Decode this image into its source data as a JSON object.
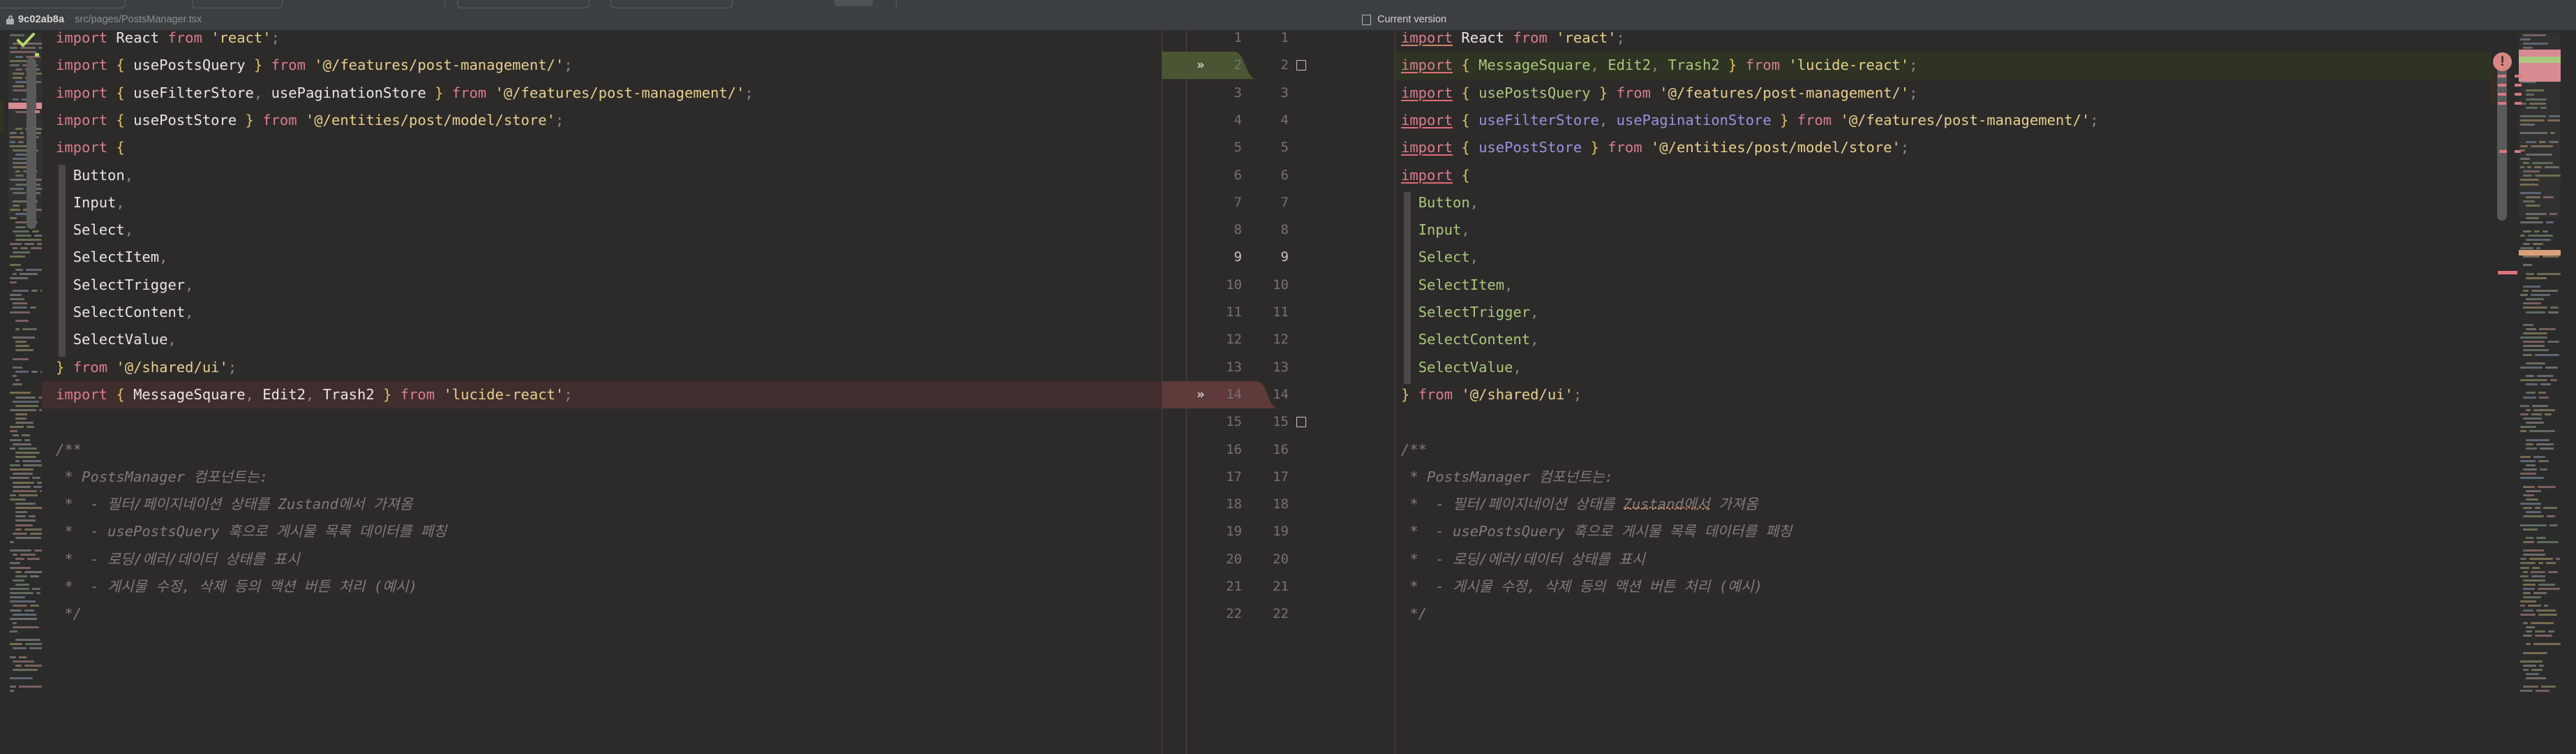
{
  "window": {
    "commit_hash": "9c02ab8a",
    "file_path": "src/pages/PostsManager.tsx",
    "current_version_label": "Current version",
    "lock_icon": "lock-icon",
    "checkmark_icon": "checkmark-icon",
    "error_badge_icon": "error-exclamation-icon",
    "error_badge_symbol": "!"
  },
  "colors": {
    "editor_bg": "#2d2a2a",
    "chrome_bg": "#3c3f41",
    "added_line_bg": "#2e3323",
    "removed_line_bg": "#402d2d",
    "added_gutter_band": "#4a5534",
    "removed_gutter_band": "#5e3a3a",
    "keyword": "#cf8e6d",
    "keyword_import": "#d97e8c",
    "string": "#e7d08c",
    "brace": "#e0c060",
    "identifier": "#e8e6e3",
    "imported_symbol_green": "#a9c77d",
    "imported_symbol_purple": "#9a93e1",
    "comment": "#7f7b77",
    "error_red": "#e06c75",
    "spellcheck_orange": "#c9866a",
    "error_badge": "#d98680",
    "scrollbar_thumb": "#5a5a5a"
  },
  "left_pane": {
    "name": "left-diff-pane",
    "lines": [
      {
        "n": 1,
        "state": "normal"
      },
      {
        "n": 2,
        "state": "normal"
      },
      {
        "n": 3,
        "state": "normal"
      },
      {
        "n": 4,
        "state": "normal"
      },
      {
        "n": 5,
        "state": "normal"
      },
      {
        "n": 6,
        "state": "normal"
      },
      {
        "n": 7,
        "state": "normal"
      },
      {
        "n": 8,
        "state": "normal"
      },
      {
        "n": 9,
        "state": "normal"
      },
      {
        "n": 10,
        "state": "normal"
      },
      {
        "n": 11,
        "state": "normal"
      },
      {
        "n": 12,
        "state": "normal"
      },
      {
        "n": 13,
        "state": "normal"
      },
      {
        "n": 14,
        "state": "removed"
      },
      {
        "n": 15,
        "state": "normal"
      },
      {
        "n": 16,
        "state": "normal"
      },
      {
        "n": 17,
        "state": "normal"
      },
      {
        "n": 18,
        "state": "normal"
      },
      {
        "n": 19,
        "state": "normal"
      },
      {
        "n": 20,
        "state": "normal"
      },
      {
        "n": 21,
        "state": "normal"
      },
      {
        "n": 22,
        "state": "normal"
      }
    ],
    "text": [
      "import React from 'react';",
      "import { usePostsQuery } from '@/features/post-management/';",
      "import { useFilterStore, usePaginationStore } from '@/features/post-management/';",
      "import { usePostStore } from '@/entities/post/model/store';",
      "import {",
      "  Button,",
      "  Input,",
      "  Select,",
      "  SelectItem,",
      "  SelectTrigger,",
      "  SelectContent,",
      "  SelectValue,",
      "} from '@/shared/ui';",
      "import { MessageSquare, Edit2, Trash2 } from 'lucide-react';",
      "",
      "/**",
      " * PostsManager 컴포넌트는:",
      " *  - 필터/페이지네이션 상태를 Zustand에서 가져옴",
      " *  - usePostsQuery 훅으로 게시물 목록 데이터를 페칭",
      " *  - 로딩/에러/데이터 상태를 표시",
      " *  - 게시물 수정, 삭제 등의 액션 버튼 처리 (예시)",
      " */"
    ]
  },
  "right_pane": {
    "name": "right-diff-pane",
    "lines": [
      {
        "n": 1,
        "state": "normal"
      },
      {
        "n": 2,
        "state": "added"
      },
      {
        "n": 3,
        "state": "normal"
      },
      {
        "n": 4,
        "state": "normal"
      },
      {
        "n": 5,
        "state": "normal"
      },
      {
        "n": 6,
        "state": "normal"
      },
      {
        "n": 7,
        "state": "normal"
      },
      {
        "n": 8,
        "state": "normal"
      },
      {
        "n": 9,
        "state": "normal"
      },
      {
        "n": 10,
        "state": "normal"
      },
      {
        "n": 11,
        "state": "normal"
      },
      {
        "n": 12,
        "state": "normal"
      },
      {
        "n": 13,
        "state": "normal"
      },
      {
        "n": 14,
        "state": "normal"
      },
      {
        "n": 15,
        "state": "normal"
      },
      {
        "n": 16,
        "state": "normal"
      },
      {
        "n": 17,
        "state": "normal"
      },
      {
        "n": 18,
        "state": "normal"
      },
      {
        "n": 19,
        "state": "normal"
      },
      {
        "n": 20,
        "state": "normal"
      },
      {
        "n": 21,
        "state": "normal"
      },
      {
        "n": 22,
        "state": "normal"
      }
    ],
    "text": [
      "import React from 'react';",
      "import { MessageSquare, Edit2, Trash2 } from 'lucide-react';",
      "import { usePostsQuery } from '@/features/post-management/';",
      "import { useFilterStore, usePaginationStore } from '@/features/post-management/';",
      "import { usePostStore } from '@/entities/post/model/store';",
      "import {",
      "  Button,",
      "  Input,",
      "  Select,",
      "  SelectItem,",
      "  SelectTrigger,",
      "  SelectContent,",
      "  SelectValue,",
      "} from '@/shared/ui';",
      "",
      "/**",
      " * PostsManager 컴포넌트는:",
      " *  - 필터/페이지네이션 상태를 Zustand에서 가져옴",
      " *  - usePostsQuery 훅으로 게시물 목록 데이터를 페칭",
      " *  - 로딩/에러/데이터 상태를 표시",
      " *  - 게시물 수정, 삭제 등의 액션 버튼 처리 (예시)",
      " */"
    ]
  },
  "gutter": {
    "name": "diff-gutter",
    "left_numbers": [
      1,
      2,
      3,
      4,
      5,
      6,
      7,
      8,
      9,
      10,
      11,
      12,
      13,
      14,
      15,
      16,
      17,
      18,
      19,
      20,
      21,
      22
    ],
    "right_numbers": [
      1,
      2,
      3,
      4,
      5,
      6,
      7,
      8,
      9,
      10,
      11,
      12,
      13,
      14,
      15,
      16,
      17,
      18,
      19,
      20,
      21,
      22
    ],
    "current_left_line": 9,
    "checkbox_rows": [
      2,
      15
    ],
    "chevron_rows": [
      2,
      14
    ],
    "chevron_glyph": "»"
  }
}
